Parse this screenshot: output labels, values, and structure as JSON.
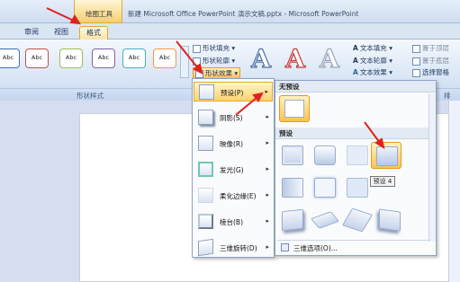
{
  "titlebar": {
    "context_tab": "绘图工具",
    "title": "新建 Microsoft Office PowerPoint 演示文稿.pptx - Microsoft PowerPoint"
  },
  "tabs": [
    {
      "label": "审阅"
    },
    {
      "label": "视图"
    },
    {
      "label": "格式"
    }
  ],
  "ribbon": {
    "style_thumbs": [
      "Abc",
      "Abc",
      "Abc",
      "Abc",
      "Abc",
      "Abc"
    ],
    "shape_fill": "形状填充 ▾",
    "shape_outline": "形状轮廓 ▾",
    "shape_effects": "形状效果 ▾",
    "wordart_letter": "A",
    "text_fill": "文本填充 ▾",
    "text_outline": "文本轮廓 ▾",
    "text_effects": "文本效果 ▾",
    "bring_front": "置于顶层",
    "send_back": "置于底层",
    "selection_pane": "选择窗格",
    "group_label": "形状样式",
    "group_label_right": "排"
  },
  "effects_menu": [
    {
      "label": "预设(P)",
      "arrow": "▸"
    },
    {
      "label": "阴影(S)",
      "arrow": "▸"
    },
    {
      "label": "映像(R)",
      "arrow": "▸"
    },
    {
      "label": "发光(G)",
      "arrow": "▸"
    },
    {
      "label": "柔化边缘(E)",
      "arrow": "▸"
    },
    {
      "label": "棱台(B)",
      "arrow": "▸"
    },
    {
      "label": "三维旋转(D)",
      "arrow": "▸"
    }
  ],
  "preset_submenu": {
    "no_preset_header": "无预设",
    "preset_header": "预设",
    "options_label": "三维选项(O)..."
  },
  "tooltip": "预设 4",
  "colors": {
    "accent_orange": "#f5b335",
    "ribbon_blue": "#dce8f6",
    "arrow_red": "#e0221c"
  }
}
